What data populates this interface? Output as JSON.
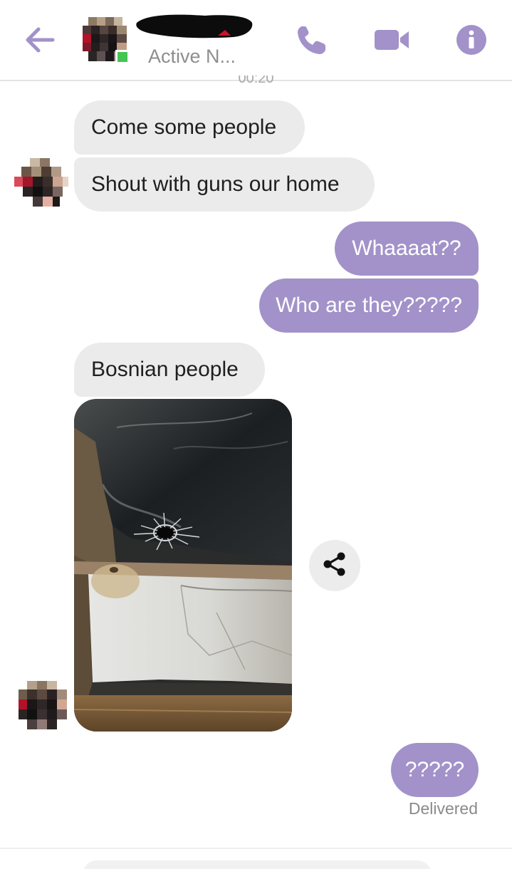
{
  "header": {
    "status": "Active N...",
    "time_peek": "00:20"
  },
  "icons": {
    "back": "arrow-left-icon",
    "call": "phone-icon",
    "video": "video-camera-icon",
    "info": "info-icon",
    "share": "share-icon"
  },
  "colors": {
    "accent": "#a292c9",
    "incoming_bubble": "#ebebeb",
    "online": "#44c553"
  },
  "messages": [
    {
      "side": "incoming",
      "text": "Come some people"
    },
    {
      "side": "incoming",
      "text": "Shout with guns our home"
    },
    {
      "side": "outgoing",
      "text": "Whaaaat??"
    },
    {
      "side": "outgoing",
      "text": "Who are they?????"
    },
    {
      "side": "incoming",
      "text": "Bosnian people"
    },
    {
      "side": "incoming",
      "type": "photo"
    },
    {
      "side": "outgoing",
      "text": "?????"
    }
  ],
  "receipt": "Delivered"
}
